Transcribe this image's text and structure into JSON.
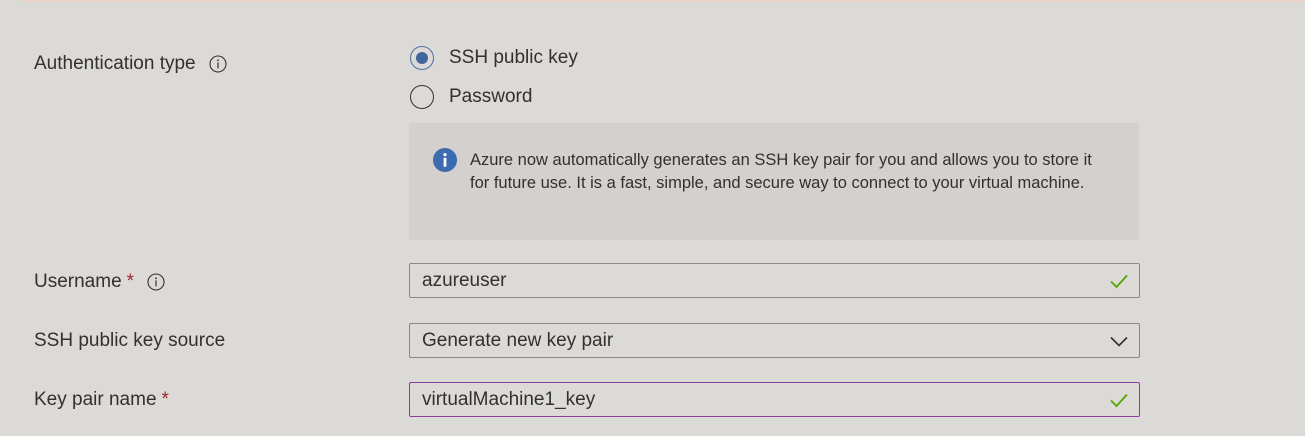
{
  "auth": {
    "label": "Authentication type",
    "options": [
      {
        "label": "SSH public key",
        "selected": true
      },
      {
        "label": "Password",
        "selected": false
      }
    ],
    "info_message": "Azure now automatically generates an SSH key pair for you and allows you to store it for future use. It is a fast, simple, and secure way to connect to your virtual machine."
  },
  "username": {
    "label": "Username",
    "required_marker": "*",
    "value": "azureuser"
  },
  "ssh_source": {
    "label": "SSH public key source",
    "selected": "Generate new key pair"
  },
  "key_pair": {
    "label": "Key pair name",
    "required_marker": "*",
    "value": "virtualMachine1_key"
  },
  "icons": {
    "info": "info-circle-icon",
    "validation": "checkmark-icon",
    "dropdown": "chevron-down-icon"
  },
  "colors": {
    "radio_selected": "#40669b",
    "required": "#a4262c",
    "valid_check": "#57a300",
    "focus_border": "#8a3e9e",
    "info_badge": "#3e6bb0"
  }
}
